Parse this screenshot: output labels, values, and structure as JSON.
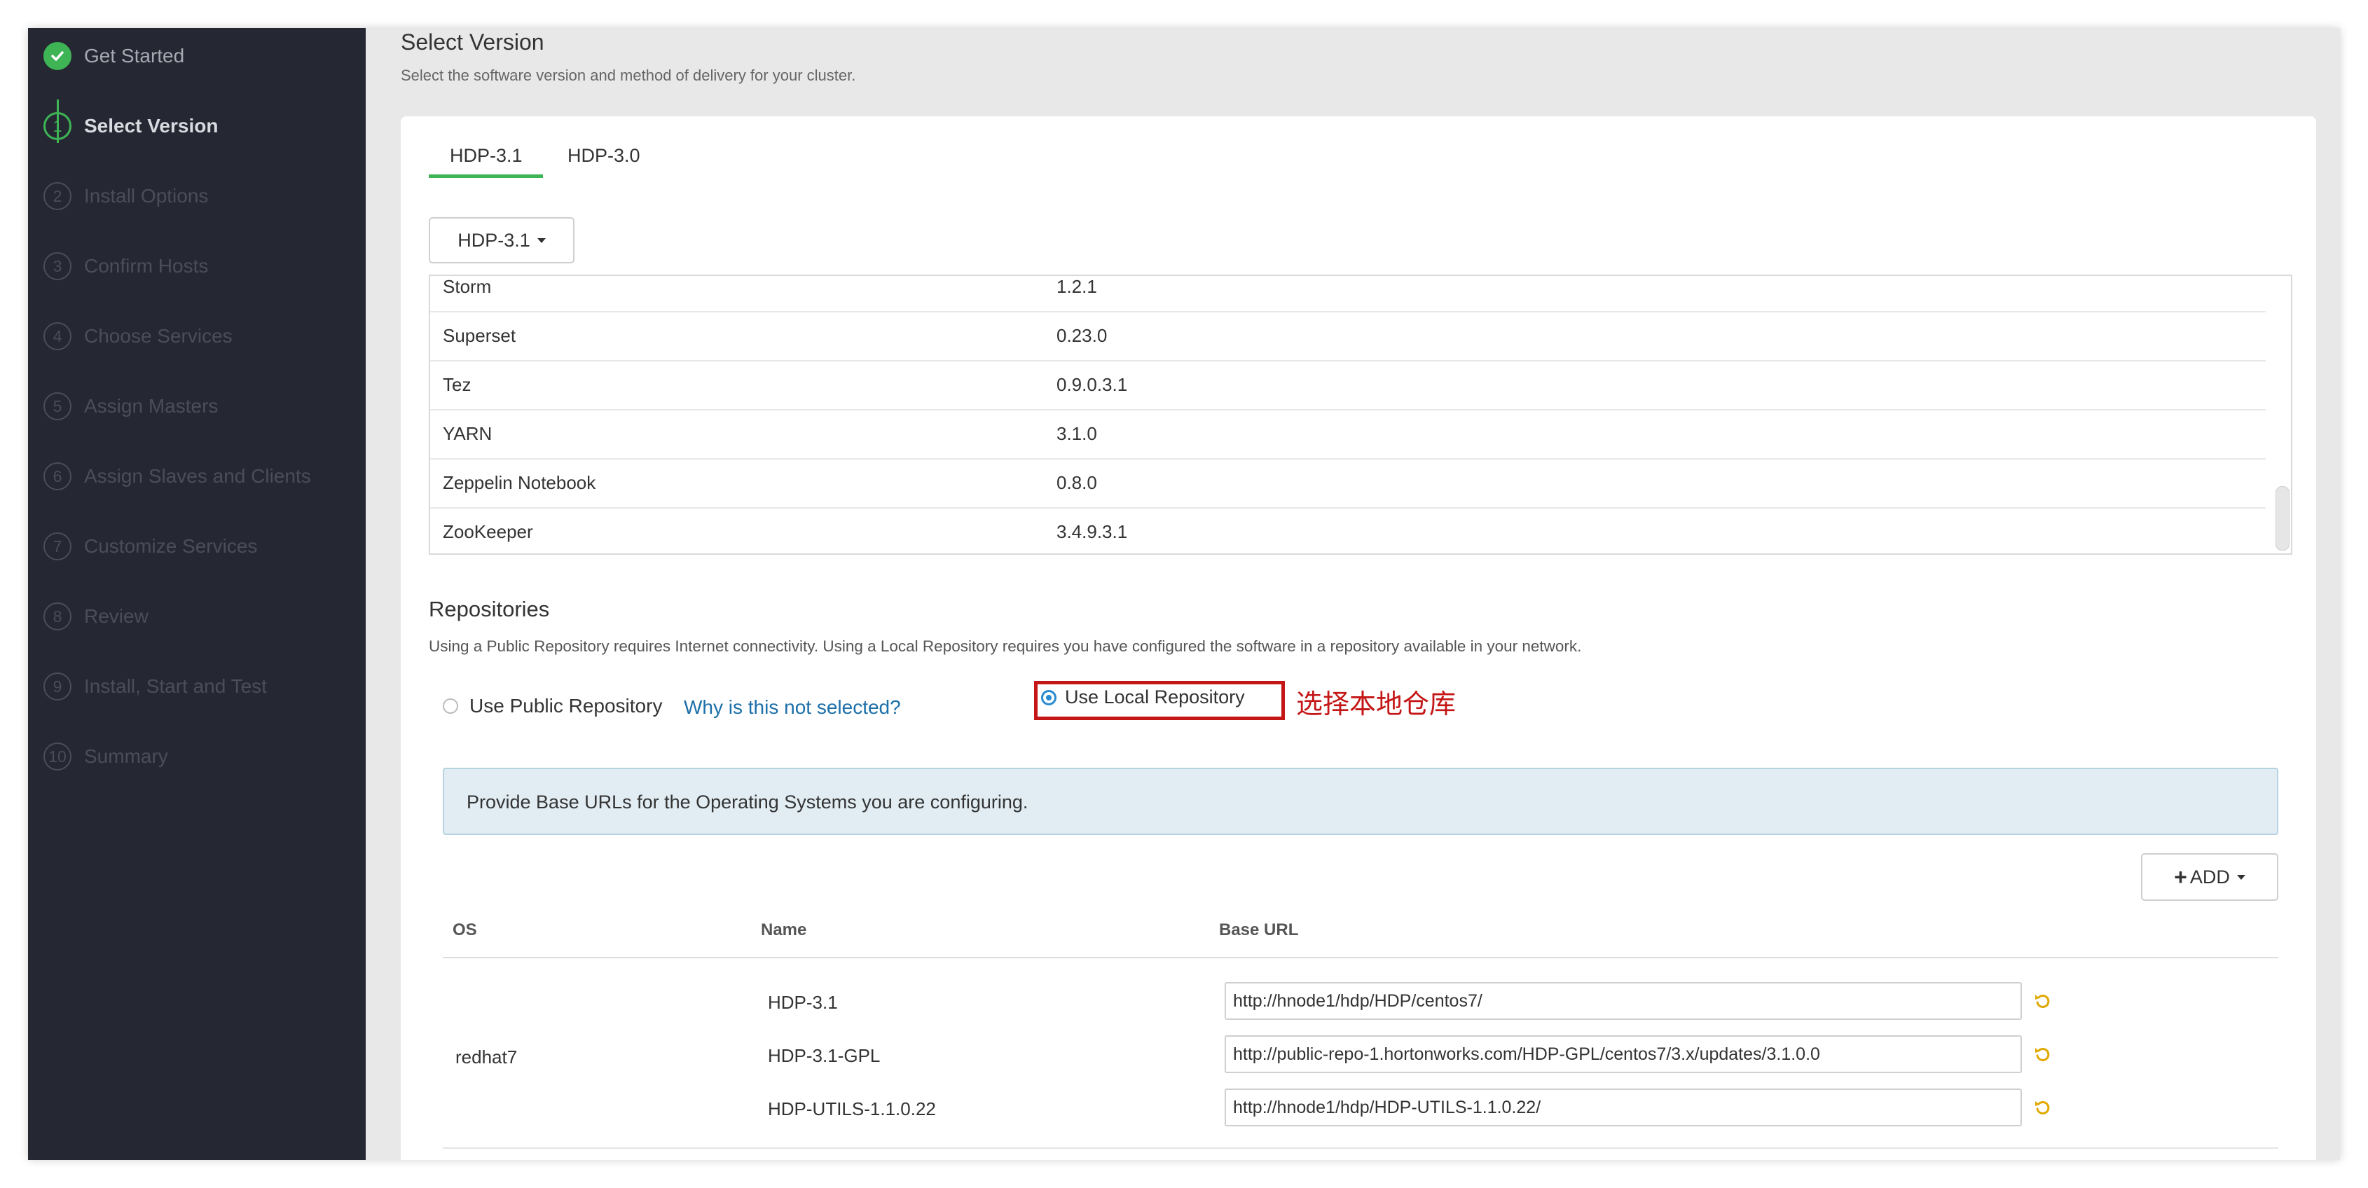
{
  "sidebar": {
    "steps": [
      {
        "num": "",
        "label": "Get Started",
        "state": "done"
      },
      {
        "num": "1",
        "label": "Select Version",
        "state": "active"
      },
      {
        "num": "2",
        "label": "Install Options",
        "state": "pending"
      },
      {
        "num": "3",
        "label": "Confirm Hosts",
        "state": "pending"
      },
      {
        "num": "4",
        "label": "Choose Services",
        "state": "pending"
      },
      {
        "num": "5",
        "label": "Assign Masters",
        "state": "pending"
      },
      {
        "num": "6",
        "label": "Assign Slaves and Clients",
        "state": "pending"
      },
      {
        "num": "7",
        "label": "Customize Services",
        "state": "pending"
      },
      {
        "num": "8",
        "label": "Review",
        "state": "pending"
      },
      {
        "num": "9",
        "label": "Install, Start and Test",
        "state": "pending"
      },
      {
        "num": "10",
        "label": "Summary",
        "state": "pending"
      }
    ]
  },
  "header": {
    "title": "Select Version",
    "subtitle": "Select the software version and method of delivery for your cluster."
  },
  "tabs": [
    {
      "label": "HDP-3.1",
      "active": true
    },
    {
      "label": "HDP-3.0",
      "active": false
    }
  ],
  "version_dropdown": {
    "value": "HDP-3.1"
  },
  "services": [
    {
      "name": "Storm",
      "version": "1.2.1"
    },
    {
      "name": "Superset",
      "version": "0.23.0"
    },
    {
      "name": "Tez",
      "version": "0.9.0.3.1"
    },
    {
      "name": "YARN",
      "version": "3.1.0"
    },
    {
      "name": "Zeppelin Notebook",
      "version": "0.8.0"
    },
    {
      "name": "ZooKeeper",
      "version": "3.4.9.3.1"
    }
  ],
  "repositories": {
    "title": "Repositories",
    "description": "Using a Public Repository requires Internet connectivity. Using a Local Repository requires you have configured the software in a repository available in your network.",
    "public_option": "Use Public Repository",
    "why_link": "Why is this not selected?",
    "local_option": "Use Local Repository",
    "selected": "local",
    "annotation": "选择本地仓库",
    "info": "Provide Base URLs for the Operating Systems you are configuring.",
    "add_button": "ADD",
    "columns": {
      "os": "OS",
      "name": "Name",
      "base_url": "Base URL"
    },
    "os": "redhat7",
    "repos": [
      {
        "name": "HDP-3.1",
        "url": "http://hnode1/hdp/HDP/centos7/"
      },
      {
        "name": "HDP-3.1-GPL",
        "url": "http://public-repo-1.hortonworks.com/HDP-GPL/centos7/3.x/updates/3.1.0.0"
      },
      {
        "name": "HDP-UTILS-1.1.0.22",
        "url": "http://hnode1/hdp/HDP-UTILS-1.1.0.22/"
      }
    ]
  },
  "colors": {
    "sidebar_bg": "#252833",
    "accent_green": "#3eb455",
    "annotation_red": "#c41616",
    "link_blue": "#1c6fa8",
    "info_bg": "#e1edf3",
    "undo_orange": "#e0a800"
  },
  "icons": {
    "check": "check-icon",
    "undo": "undo-icon",
    "caret": "caret-down-icon",
    "plus": "plus-icon"
  }
}
